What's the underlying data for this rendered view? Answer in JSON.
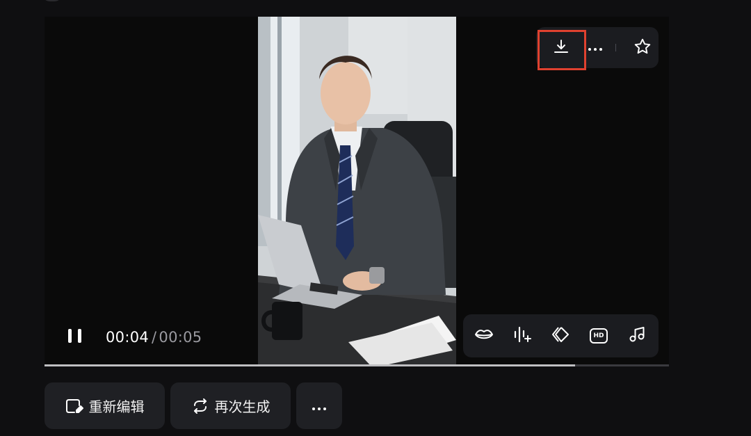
{
  "player": {
    "current_time": "00:04",
    "separator": "/",
    "total_time": "00:05",
    "progress_fraction": 0.85
  },
  "top_toolbar": {
    "download_icon": "download-icon",
    "more_icon": "more-horizontal-icon",
    "favorite_icon": "star-icon"
  },
  "bottom_toolbar": {
    "items": [
      "lips-icon",
      "voice-sparkle-icon",
      "diamond-arrows-icon",
      "hd-icon",
      "music-note-icon"
    ],
    "hd_label": "HD"
  },
  "actions": {
    "reedit_label": "重新编辑",
    "regenerate_label": "再次生成"
  },
  "colors": {
    "background": "#0f0f11",
    "highlight": "#e0412f",
    "toolbar": "#1b1c20",
    "button": "#1f2024"
  }
}
